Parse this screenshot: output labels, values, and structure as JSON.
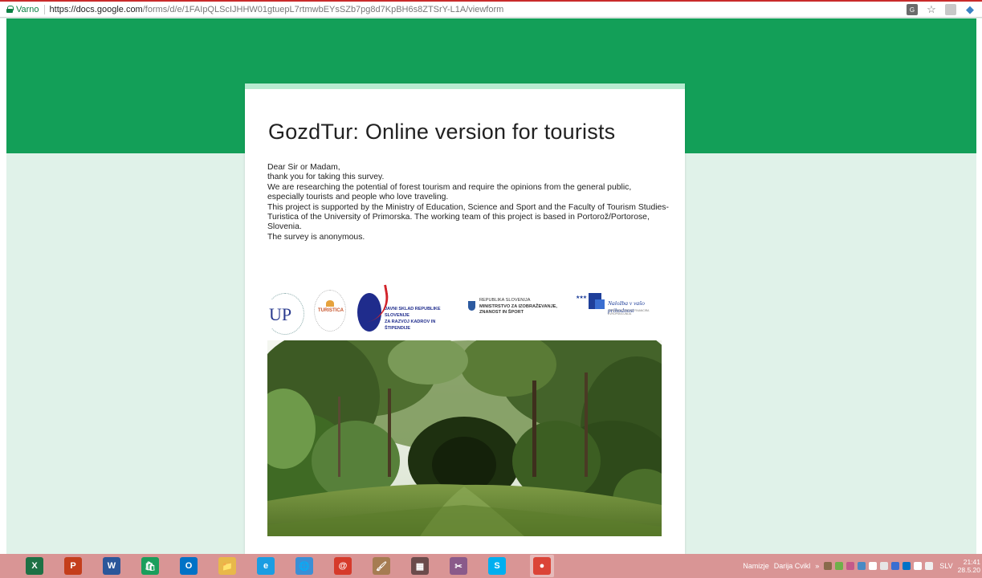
{
  "browser": {
    "secure_label": "Varno",
    "url_host": "https://docs.google.com",
    "url_path": "/forms/d/e/1FAIpQLScIJHHW01gtuepL7rtmwbEYsSZb7pg8d7KpBH6s8ZTSrY-L1A/viewform",
    "icons": [
      "translate-icon",
      "bookmark-star-icon",
      "extension-icon",
      "extension-diamond-icon"
    ]
  },
  "form": {
    "title": "GozdTur: Online version for tourists",
    "description": [
      "Dear Sir or Madam,",
      "thank you for taking this survey.",
      "We are researching the potential of forest tourism and require the opinions from the general public, especially tourists and people who love traveling.",
      "This project is supported by the Ministry of Education, Science and Sport and the Faculty of Tourism Studies-Turistica of the University of Primorska. The working team of this project is  based in Portorož/Portorose, Slovenia.",
      "The survey is anonymous."
    ],
    "logos": {
      "up": "UP",
      "turistica": "TURISTICA",
      "jskrs_line1": "JAVNI SKLAD REPUBLIKE SLOVENIJE",
      "jskrs_line2": "ZA RAZVOJ KADROV IN ŠTIPENDIJE",
      "mizs_line1": "REPUBLIKA SLOVENIJA",
      "mizs_line2": "MINISTRSTVO ZA IZOBRAŽEVANJE,",
      "mizs_line3": "ZNANOST IN ŠPORT",
      "eu_text": "Naložba v vašo prihodnost",
      "eu_sub": "OPERACIJO DELNO FINANCIRA EVROPSKA UNIJA"
    }
  },
  "colors": {
    "header_green": "#139f58",
    "page_background": "#e0f2e9",
    "card_accent": "#b7ebd0",
    "taskbar": "#d99595"
  },
  "taskbar": {
    "apps": [
      {
        "name": "excel-icon",
        "label": "X",
        "color": "#1e7145"
      },
      {
        "name": "powerpoint-icon",
        "label": "P",
        "color": "#c43e1c"
      },
      {
        "name": "word-icon",
        "label": "W",
        "color": "#2b579a"
      },
      {
        "name": "store-icon",
        "label": "🛍",
        "color": "#1a9e5c"
      },
      {
        "name": "outlook-icon",
        "label": "O",
        "color": "#0072c6"
      },
      {
        "name": "file-explorer-icon",
        "label": "📁",
        "color": "#e8b84a"
      },
      {
        "name": "internet-explorer-icon",
        "label": "e",
        "color": "#1b9de2"
      },
      {
        "name": "globe-icon",
        "label": "🌐",
        "color": "#3a8fd6"
      },
      {
        "name": "red-app-icon",
        "label": "@",
        "color": "#d63a2b"
      },
      {
        "name": "paint-app-icon",
        "label": "🖌",
        "color": "#a67c52"
      },
      {
        "name": "media-app-icon",
        "label": "▦",
        "color": "#6b4b4b"
      },
      {
        "name": "snipping-tool-icon",
        "label": "✂",
        "color": "#8a5a8a"
      },
      {
        "name": "skype-icon",
        "label": "S",
        "color": "#00aff0"
      },
      {
        "name": "chrome-icon",
        "label": "●",
        "color": "#db4437"
      }
    ],
    "desktop_label": "Namizje",
    "user_folder": "Darija Cvikl",
    "language": "SLV",
    "time": "21:41",
    "date": "28.5.20"
  }
}
